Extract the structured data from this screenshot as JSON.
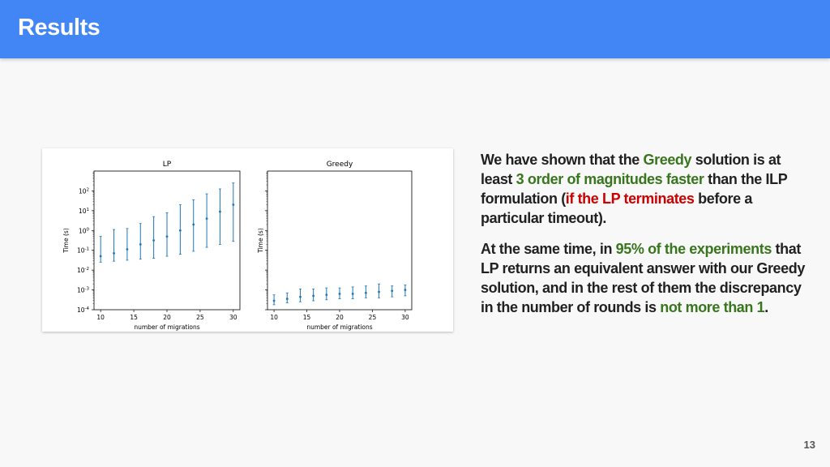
{
  "slide": {
    "title": "Results",
    "page_number": "13"
  },
  "paragraph1": {
    "s1": "We have shown that the ",
    "s2": "Greedy",
    "s3": " solution is at least ",
    "s4": "3 order of magnitudes faster",
    "s5": " than the ILP formulation (",
    "s6": "if the LP terminates",
    "s7": " before a particular timeout)."
  },
  "paragraph2": {
    "s1": "At the same time, in ",
    "s2": "95% of the experiments",
    "s3": " that LP returns an equivalent answer with our Greedy solution, and in the rest of them the discrepancy in the number of rounds is ",
    "s4": "not more than 1",
    "s5": "."
  },
  "colors": {
    "header": "#4285f4",
    "highlight_green": "#38761d",
    "highlight_red": "#cc0000",
    "series": "#1f77b4"
  },
  "chart_data": [
    {
      "type": "scatter",
      "title": "LP",
      "xlabel": "number of migrations",
      "ylabel": "Time (s)",
      "yscale": "log",
      "xticks": [
        "10",
        "15",
        "20",
        "25",
        "30"
      ],
      "yticks": [
        "10^2",
        "10^1",
        "10^0",
        "10^-1",
        "10^-2",
        "10^-3",
        "10^-4"
      ],
      "xlim": [
        9,
        31
      ],
      "ylim_exp": [
        -4,
        3
      ],
      "series": [
        {
          "error_bars": true,
          "points": [
            {
              "x": 10,
              "y_exp": -1.3,
              "lo_exp": -1.6,
              "hi_exp": -0.3
            },
            {
              "x": 12,
              "y_exp": -1.15,
              "lo_exp": -1.55,
              "hi_exp": 0.05
            },
            {
              "x": 14,
              "y_exp": -0.95,
              "lo_exp": -1.5,
              "hi_exp": 0.1
            },
            {
              "x": 16,
              "y_exp": -0.7,
              "lo_exp": -1.45,
              "hi_exp": 0.35
            },
            {
              "x": 18,
              "y_exp": -0.5,
              "lo_exp": -1.4,
              "hi_exp": 0.7
            },
            {
              "x": 20,
              "y_exp": -0.3,
              "lo_exp": -1.3,
              "hi_exp": 0.9
            },
            {
              "x": 22,
              "y_exp": 0.0,
              "lo_exp": -1.2,
              "hi_exp": 1.3
            },
            {
              "x": 24,
              "y_exp": 0.3,
              "lo_exp": -1.05,
              "hi_exp": 1.55
            },
            {
              "x": 26,
              "y_exp": 0.6,
              "lo_exp": -0.85,
              "hi_exp": 1.85
            },
            {
              "x": 28,
              "y_exp": 0.95,
              "lo_exp": -0.7,
              "hi_exp": 2.1
            },
            {
              "x": 30,
              "y_exp": 1.3,
              "lo_exp": -0.55,
              "hi_exp": 2.4
            }
          ]
        }
      ]
    },
    {
      "type": "scatter",
      "title": "Greedy",
      "xlabel": "number of migrations",
      "ylabel": "Time (s)",
      "yscale": "log",
      "xticks": [
        "10",
        "15",
        "20",
        "25",
        "30"
      ],
      "xlim": [
        9,
        31
      ],
      "ylim_exp": [
        -4,
        3
      ],
      "series": [
        {
          "error_bars": true,
          "points": [
            {
              "x": 10,
              "y_exp": -3.55,
              "lo_exp": -3.75,
              "hi_exp": -3.25
            },
            {
              "x": 12,
              "y_exp": -3.45,
              "lo_exp": -3.65,
              "hi_exp": -3.15
            },
            {
              "x": 14,
              "y_exp": -3.35,
              "lo_exp": -3.6,
              "hi_exp": -2.95
            },
            {
              "x": 16,
              "y_exp": -3.3,
              "lo_exp": -3.55,
              "hi_exp": -2.95
            },
            {
              "x": 18,
              "y_exp": -3.25,
              "lo_exp": -3.5,
              "hi_exp": -2.9
            },
            {
              "x": 20,
              "y_exp": -3.2,
              "lo_exp": -3.45,
              "hi_exp": -2.9
            },
            {
              "x": 22,
              "y_exp": -3.2,
              "lo_exp": -3.45,
              "hi_exp": -2.85
            },
            {
              "x": 24,
              "y_exp": -3.15,
              "lo_exp": -3.4,
              "hi_exp": -2.8
            },
            {
              "x": 26,
              "y_exp": -3.1,
              "lo_exp": -3.4,
              "hi_exp": -2.7
            },
            {
              "x": 28,
              "y_exp": -3.05,
              "lo_exp": -3.35,
              "hi_exp": -2.8
            },
            {
              "x": 30,
              "y_exp": -3.0,
              "lo_exp": -3.3,
              "hi_exp": -2.75
            }
          ]
        }
      ]
    }
  ]
}
